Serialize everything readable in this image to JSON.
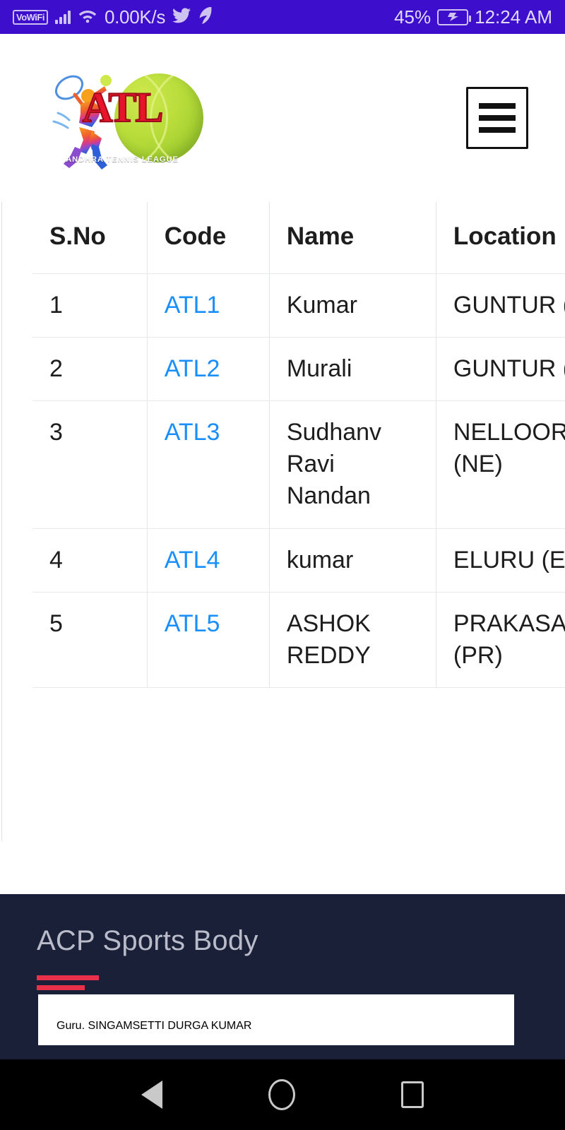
{
  "statusbar": {
    "vowifi_label": "VoWiFi",
    "network_speed": "0.00K/s",
    "battery_percent": "45%",
    "clock": "12:24 AM",
    "icons": [
      "vowifi-icon",
      "signal-bars-icon",
      "wifi-icon",
      "twitter-icon",
      "app-icon",
      "battery-charging-icon"
    ],
    "bar_color": "#3d0ecb"
  },
  "header": {
    "logo_title": "ATL",
    "logo_subtitle": "ANDHRA TENNIS LEAGUE",
    "menu_label": "Menu"
  },
  "table": {
    "columns": [
      "S.No",
      "Code",
      "Name",
      "Location"
    ],
    "rows": [
      {
        "sno": "1",
        "code": "ATL1",
        "name": "Kumar",
        "location": "GUNTUR (GT)"
      },
      {
        "sno": "2",
        "code": "ATL2",
        "name": "Murali",
        "location": "GUNTUR (GT)"
      },
      {
        "sno": "3",
        "code": "ATL3",
        "name": "Sudhanv Ravi Nandan",
        "location": "NELLOORE (NE)"
      },
      {
        "sno": "4",
        "code": "ATL4",
        "name": "kumar",
        "location": "ELURU (EL)"
      },
      {
        "sno": "5",
        "code": "ATL5",
        "name": "ASHOK REDDY",
        "location": "PRAKASAM (PR)"
      }
    ],
    "link_color": "#1a8ffc"
  },
  "footer": {
    "heading": "ACP Sports Body",
    "accent_color": "#e8304a",
    "background_color": "#1b2039",
    "card_name": "Guru. SINGAMSETTI DURGA KUMAR"
  },
  "navbar": {
    "back_label": "Back",
    "home_label": "Home",
    "recents_label": "Recents"
  }
}
